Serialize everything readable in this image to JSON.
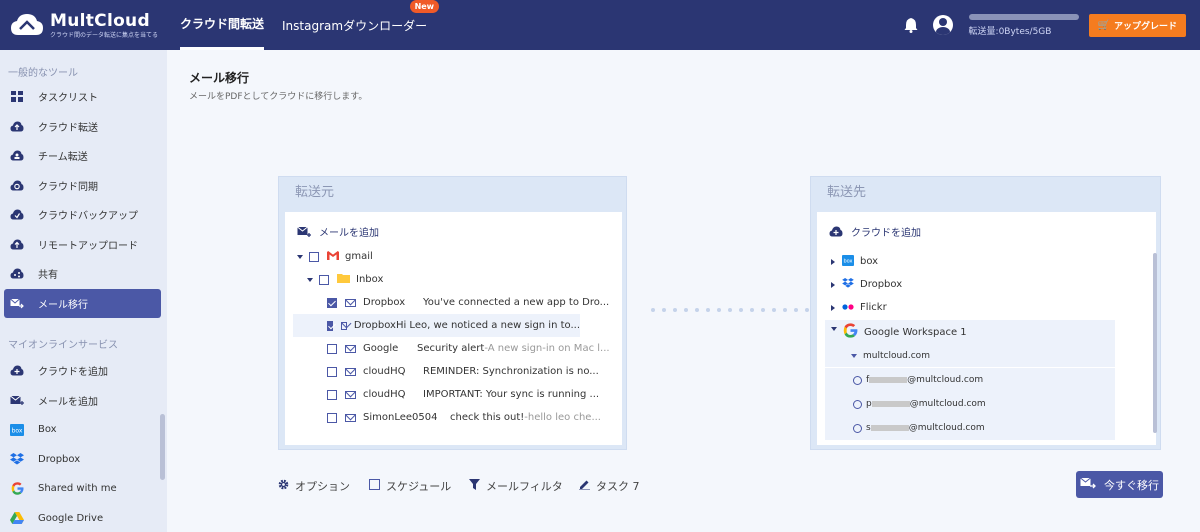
{
  "header": {
    "logo_name": "MultCloud",
    "logo_sub": "クラウド間のデータ転送に集点を当てる",
    "tabs": [
      {
        "label": "クラウド間転送"
      },
      {
        "label": "Instagramダウンローダー",
        "badge": "New"
      }
    ],
    "quota_text": "転送量:0Bytes/5GB",
    "upgrade_label": "アップグレード"
  },
  "sidebar": {
    "section1": "一般的なツール",
    "items": [
      {
        "label": "タスクリスト",
        "icon": "grid-icon"
      },
      {
        "label": "クラウド転送",
        "icon": "cloud-transfer-icon"
      },
      {
        "label": "チーム転送",
        "icon": "team-transfer-icon"
      },
      {
        "label": "クラウド同期",
        "icon": "cloud-sync-icon"
      },
      {
        "label": "クラウドバックアップ",
        "icon": "cloud-backup-icon"
      },
      {
        "label": "リモートアップロード",
        "icon": "remote-upload-icon"
      },
      {
        "label": "共有",
        "icon": "share-icon"
      },
      {
        "label": "メール移行",
        "icon": "email-migration-icon"
      }
    ],
    "section2": "マイオンラインサービス",
    "services": [
      {
        "label": "クラウドを追加",
        "icon": "add-cloud-icon"
      },
      {
        "label": "メールを追加",
        "icon": "add-mail-icon"
      },
      {
        "label": "Box",
        "icon": "box-icon"
      },
      {
        "label": "Dropbox",
        "icon": "dropbox-icon"
      },
      {
        "label": "Shared with me",
        "icon": "google-drive-icon"
      },
      {
        "label": "Google Drive",
        "icon": "google-drive-icon"
      }
    ]
  },
  "main": {
    "title": "メール移行",
    "desc": "メールをPDFとしてクラウドに移行します。",
    "source": {
      "title": "転送元",
      "add_label": "メールを追加",
      "account": "gmail",
      "folder": "Inbox",
      "emails": [
        {
          "sender": "Dropbox",
          "subject": "You've connected a new app to Dro...",
          "preview": "",
          "checked": true
        },
        {
          "sender": "Dropbox",
          "subject": "Hi Leo, we noticed a new sign in to...",
          "preview": "",
          "checked": true
        },
        {
          "sender": "Google",
          "subject": "Security alert",
          "preview": "-A new sign-in on Mac l...",
          "checked": false
        },
        {
          "sender": "cloudHQ",
          "subject": "REMINDER: Synchronization is no...",
          "preview": "",
          "checked": false
        },
        {
          "sender": "cloudHQ",
          "subject": "IMPORTANT: Your sync is running ...",
          "preview": "",
          "checked": false
        },
        {
          "sender": "SimonLee0504",
          "subject": "check this out!",
          "preview": "-hello leo che...",
          "checked": false
        }
      ]
    },
    "dest": {
      "title": "転送先",
      "add_label": "クラウドを追加",
      "clouds": [
        {
          "label": "box"
        },
        {
          "label": "Dropbox"
        },
        {
          "label": "Flickr"
        },
        {
          "label": "Google Workspace 1"
        }
      ],
      "domain": "multcloud.com",
      "accounts": [
        {
          "prefix": "f",
          "suffix": "@multcloud.com"
        },
        {
          "prefix": "p",
          "suffix": "@multcloud.com"
        },
        {
          "prefix": "s",
          "suffix": "@multcloud.com"
        }
      ]
    },
    "options": {
      "option": "オプション",
      "schedule": "スケジュール",
      "filter": "メールフィルタ",
      "task": "タスク 7"
    },
    "go_label": "今すぐ移行"
  }
}
